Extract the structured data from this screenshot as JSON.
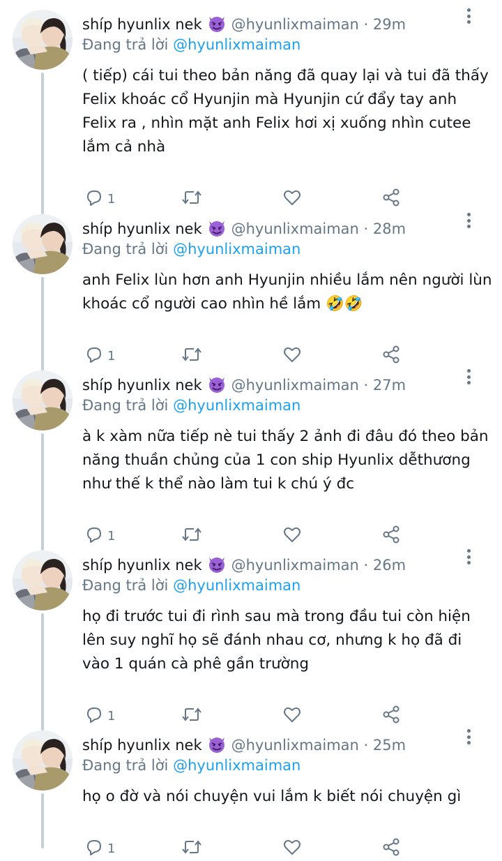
{
  "colors": {
    "accent": "#1da1f2",
    "muted": "#657786",
    "text": "#14171a",
    "thread": "#c4cfd6"
  },
  "tweets": [
    {
      "name": "shíp hyunlix nek",
      "name_emoji": "smiling-face-with-horns",
      "handle": "@hyunlixmaiman",
      "separator": "·",
      "time": "29m",
      "reply_label": "Đang trả lời",
      "reply_to": "@hyunlixmaiman",
      "lines": [
        "( tiếp) cái tui theo bản năng đã quay lại và tui đã thấy",
        "Felix khoác cổ Hyunjin mà Hyunjin cứ đẩy tay anh",
        "Felix ra ,  nhìn mặt anh Felix hơi xị xuống nhìn cutee",
        "lắm cả nhà"
      ],
      "reply_count": "1"
    },
    {
      "name": "shíp hyunlix nek",
      "name_emoji": "smiling-face-with-horns",
      "handle": "@hyunlixmaiman",
      "separator": "·",
      "time": "28m",
      "reply_label": "Đang trả lời",
      "reply_to": "@hyunlixmaiman",
      "lines": [
        "anh Felix lùn hơn anh Hyunjin nhiều lắm nên người lùn",
        "khoác cổ người cao nhìn hề lắm 🤣🤣"
      ],
      "reply_count": "1"
    },
    {
      "name": "shíp hyunlix nek",
      "name_emoji": "smiling-face-with-horns",
      "handle": "@hyunlixmaiman",
      "separator": "·",
      "time": "27m",
      "reply_label": "Đang trả lời",
      "reply_to": "@hyunlixmaiman",
      "lines": [
        "à k xàm nữa tiếp nè tui thấy 2 ảnh đi đâu đó theo bản",
        "năng thuần chủng của 1 con ship Hyunlix dễthương",
        "như thế k thể nào làm tui k chú ý đc"
      ],
      "reply_count": "1"
    },
    {
      "name": "shíp hyunlix nek",
      "name_emoji": "smiling-face-with-horns",
      "handle": "@hyunlixmaiman",
      "separator": "·",
      "time": "26m",
      "reply_label": "Đang trả lời",
      "reply_to": "@hyunlixmaiman",
      "lines": [
        "họ đi trước tui đi rình sau mà trong đầu tui còn hiện",
        "lên suy nghĩ họ sẽ đánh nhau cơ,  nhưng k họ đã đi",
        "vào 1 quán cà phê gần trường"
      ],
      "reply_count": "1"
    },
    {
      "name": "shíp hyunlix nek",
      "name_emoji": "smiling-face-with-horns",
      "handle": "@hyunlixmaiman",
      "separator": "·",
      "time": "25m",
      "reply_label": "Đang trả lời",
      "reply_to": "@hyunlixmaiman",
      "lines": [
        "họ o đờ và nói chuyện vui lắm k biết nói chuyện gì"
      ],
      "reply_count": "1"
    }
  ]
}
